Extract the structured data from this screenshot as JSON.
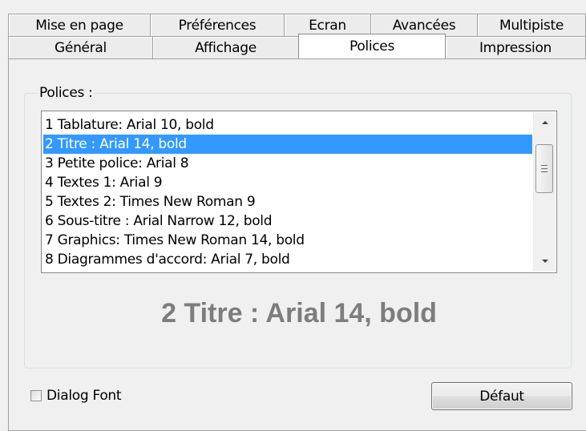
{
  "tabs_back": [
    "Mise en page",
    "Préférences",
    "Ecran",
    "Avancées",
    "Multipiste"
  ],
  "tabs_front": [
    "Général",
    "Affichage",
    "Polices",
    "Impression"
  ],
  "active_tab": "Polices",
  "group": {
    "legend": "Polices :"
  },
  "fonts_list": {
    "items": [
      "1 Tablature: Arial 10, bold",
      "2 Titre : Arial 14, bold",
      "3 Petite police: Arial 8",
      "4 Textes 1: Arial 9",
      "5 Textes 2: Times New Roman 9",
      "6 Sous-titre : Arial Narrow 12, bold",
      "7 Graphics: Times New Roman 14, bold",
      "8 Diagrammes d'accord: Arial 7, bold"
    ],
    "selected_index": 1
  },
  "preview": {
    "text": "2 Titre : Arial 14, bold"
  },
  "dialog_font": {
    "label": "Dialog Font",
    "checked": false
  },
  "default_button": {
    "label": "Défaut"
  },
  "colors": {
    "selection": "#3399ff",
    "preview_text": "#7d7d7d",
    "dialog_background": "#f0f0f0"
  }
}
